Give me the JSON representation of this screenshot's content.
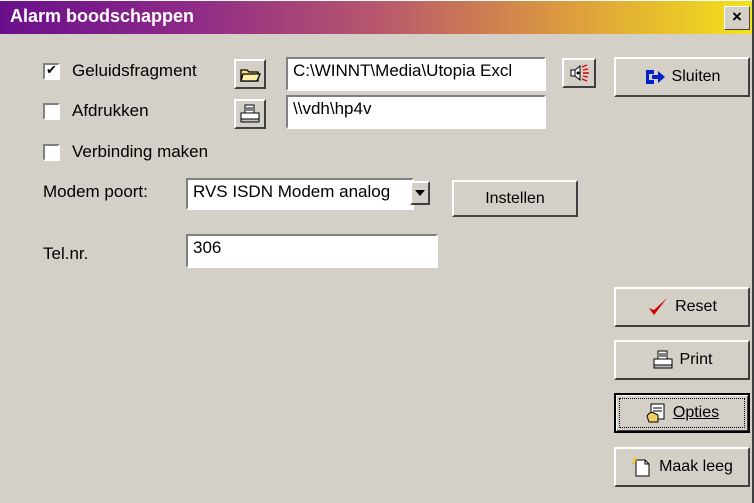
{
  "window": {
    "title": "Alarm boodschappen",
    "close_glyph": "×"
  },
  "options": {
    "sound": {
      "label": "Geluidsfragment",
      "checked": true,
      "check_glyph": "✔",
      "path": "C:\\WINNT\\Media\\Utopia Excl"
    },
    "print": {
      "label": "Afdrukken",
      "checked": false,
      "path": "\\\\vdh\\hp4v"
    },
    "connect": {
      "label": "Verbinding maken",
      "checked": false
    }
  },
  "modem": {
    "label": "Modem poort:",
    "selected": "RVS ISDN Modem analog",
    "setup_button": "Instellen"
  },
  "phone": {
    "label": "Tel.nr.",
    "value": "306"
  },
  "buttons": {
    "close": "Sluiten",
    "reset": "Reset",
    "print": "Print",
    "options": "Opties",
    "clear": "Maak leeg"
  },
  "colors": {
    "accent_purple": "#6a0f8c",
    "accent_yellow": "#f2e21a",
    "reset_check": "#d40000",
    "sluiten_arrow": "#0020c8"
  },
  "icons": {
    "folder": "folder-open-icon",
    "printer": "printer-icon",
    "speaker": "speaker-icon",
    "exit": "exit-arrow-icon",
    "check": "checkmark-icon",
    "options": "options-hand-icon",
    "clear": "new-page-icon"
  }
}
